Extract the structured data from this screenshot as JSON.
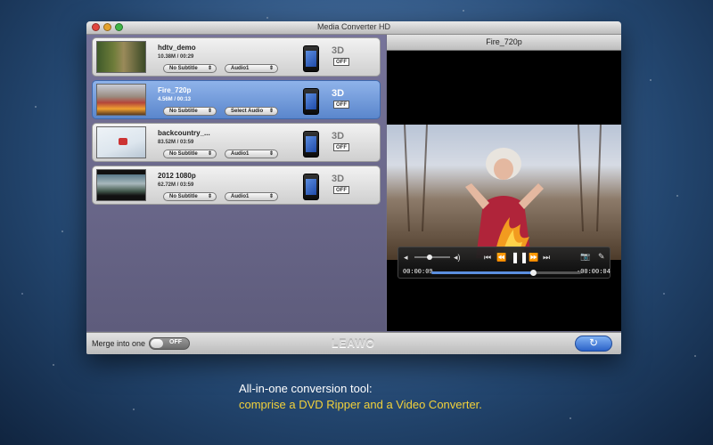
{
  "window": {
    "title": "Media Converter HD"
  },
  "files": [
    {
      "name": "hdtv_demo",
      "meta": "10.38M / 00:29",
      "subtitle": "No Subtitle",
      "audio": "Audio1",
      "three_d": "3D",
      "toggle": "OFF",
      "selected": false
    },
    {
      "name": "Fire_720p",
      "meta": "4.56M / 00:13",
      "subtitle": "No Subtitle",
      "audio": "Select Audio",
      "three_d": "3D",
      "toggle": "OFF",
      "selected": true
    },
    {
      "name": "backcountry_...",
      "meta": "83.52M / 03:59",
      "subtitle": "No Subtitle",
      "audio": "Audio1",
      "three_d": "3D",
      "toggle": "OFF",
      "selected": false
    },
    {
      "name": "2012 1080p",
      "meta": "62.72M / 03:59",
      "subtitle": "No Subtitle",
      "audio": "Audio1",
      "three_d": "3D",
      "toggle": "OFF",
      "selected": false
    }
  ],
  "preview": {
    "title": "Fire_720p",
    "elapsed": "00:00:09",
    "remaining": "-00:00:04",
    "progress": 0.68
  },
  "bottom": {
    "merge_label": "Merge into one",
    "merge_state": "OFF",
    "logo": "LEAWO"
  },
  "caption": {
    "line1": "All-in-one conversion tool:",
    "line2": "comprise a DVD Ripper and a Video Converter."
  },
  "icons": {
    "close": "close-icon",
    "minimize": "minimize-icon",
    "zoom": "zoom-icon",
    "device": "iphone-icon",
    "volume": "volume-icon",
    "rewind": "rewind-icon",
    "play_pause": "pause-icon",
    "forward": "fast-forward-icon",
    "snapshot": "camera-icon",
    "edit": "edit-icon",
    "convert": "convert-icon"
  }
}
